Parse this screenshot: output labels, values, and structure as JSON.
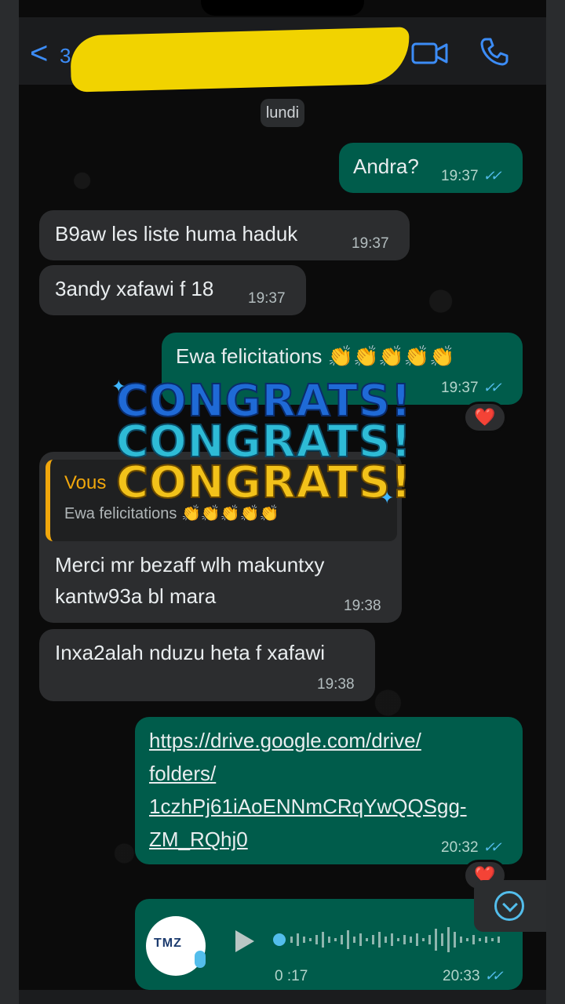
{
  "header": {
    "back_label": "<",
    "contact_partial": "3",
    "video_icon": "video-camera-icon",
    "phone_icon": "phone-icon"
  },
  "date_separator": "lundi",
  "messages": [
    {
      "dir": "out",
      "text": "Andra?",
      "time": "19:37",
      "status": "read"
    },
    {
      "dir": "in",
      "text": "B9aw les liste huma haduk",
      "time": "19:37"
    },
    {
      "dir": "in",
      "text": "3andy xafawi f 18",
      "time": "19:37"
    },
    {
      "dir": "out",
      "text": "Ewa felicitations 👏👏👏👏👏",
      "time": "19:37",
      "status": "read",
      "reaction": "❤️",
      "sticker_text": [
        "CONGRATS!",
        "CONGRATS!",
        "CONGRATS!"
      ]
    },
    {
      "dir": "in",
      "quote_author": "Vous",
      "quote_text": "Ewa felicitations 👏👏👏👏👏",
      "text_lines": [
        "Merci mr bezaff wlh makuntxy",
        "kantw93a bl mara"
      ],
      "time": "19:38"
    },
    {
      "dir": "in",
      "text": "Inxa2alah nduzu heta f xafawi",
      "time": "19:38"
    },
    {
      "dir": "out",
      "link_lines": [
        "https://drive.google.com/drive/",
        "folders/",
        "1czhPj61iAoENNmCRqYwQQSgg-",
        "ZM_RQhj0"
      ],
      "time": "20:32",
      "status": "read",
      "reaction": "❤️"
    },
    {
      "dir": "out",
      "type": "voice",
      "avatar_text": "TMZ",
      "duration": "0 :17",
      "time": "20:33",
      "status": "read"
    }
  ],
  "ticks": "✓✓",
  "colors": {
    "outgoing": "#005c4b",
    "incoming": "#2c2d2f",
    "accent": "#53bdeb",
    "quote_accent": "#f1a70c"
  }
}
